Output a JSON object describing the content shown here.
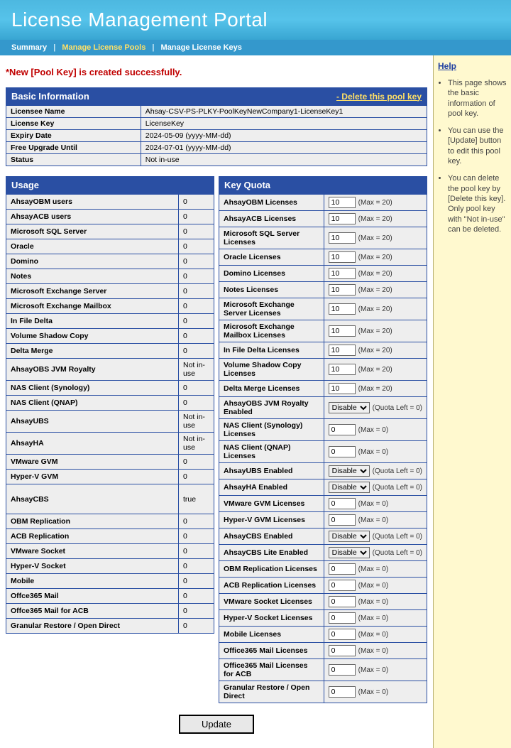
{
  "header": {
    "title": "License Management Portal"
  },
  "nav": {
    "summary": "Summary",
    "pools": "Manage License Pools",
    "keys": "Manage License Keys"
  },
  "message": "*New [Pool Key] is created successfully.",
  "basic": {
    "heading": "Basic Information",
    "deleteLink": "- Delete this pool key",
    "rows": [
      {
        "label": "Licensee Name",
        "value": "Ahsay-CSV-PS-PLKY-PoolKeyNewCompany1-LicenseKey1"
      },
      {
        "label": "License Key",
        "value": "LicenseKey"
      },
      {
        "label": "Expiry Date",
        "value": "2024-05-09 (yyyy-MM-dd)"
      },
      {
        "label": "Free Upgrade Until",
        "value": "2024-07-01 (yyyy-MM-dd)"
      },
      {
        "label": "Status",
        "value": "Not in-use"
      }
    ]
  },
  "usage": {
    "heading": "Usage",
    "rows": [
      {
        "label": "AhsayOBM users",
        "value": "0"
      },
      {
        "label": "AhsayACB users",
        "value": "0"
      },
      {
        "label": "Microsoft SQL Server",
        "value": "0"
      },
      {
        "label": "Oracle",
        "value": "0"
      },
      {
        "label": "Domino",
        "value": "0"
      },
      {
        "label": "Notes",
        "value": "0"
      },
      {
        "label": "Microsoft Exchange Server",
        "value": "0"
      },
      {
        "label": "Microsoft Exchange Mailbox",
        "value": "0"
      },
      {
        "label": "In File Delta",
        "value": "0"
      },
      {
        "label": "Volume Shadow Copy",
        "value": "0"
      },
      {
        "label": "Delta Merge",
        "value": "0"
      },
      {
        "label": "AhsayOBS JVM Royalty",
        "value": "Not in-use"
      },
      {
        "label": "NAS Client (Synology)",
        "value": "0"
      },
      {
        "label": "NAS Client (QNAP)",
        "value": "0"
      },
      {
        "label": "AhsayUBS",
        "value": "Not in-use"
      },
      {
        "label": "AhsayHA",
        "value": "Not in-use"
      },
      {
        "label": "VMware GVM",
        "value": "0"
      },
      {
        "label": "Hyper-V GVM",
        "value": "0"
      },
      {
        "label": "AhsayCBS",
        "value": "true",
        "span": 2
      },
      {
        "label": "OBM Replication",
        "value": "0"
      },
      {
        "label": "ACB Replication",
        "value": "0"
      },
      {
        "label": "VMware Socket",
        "value": "0"
      },
      {
        "label": "Hyper-V Socket",
        "value": "0"
      },
      {
        "label": "Mobile",
        "value": "0"
      },
      {
        "label": "Offce365 Mail",
        "value": "0"
      },
      {
        "label": "Offce365 Mail for ACB",
        "value": "0"
      },
      {
        "label": "Granular Restore / Open Direct",
        "value": "0"
      }
    ]
  },
  "quota": {
    "heading": "Key Quota",
    "rows": [
      {
        "label": "AhsayOBM Licenses",
        "type": "num",
        "value": "10",
        "hint": "(Max = 20)"
      },
      {
        "label": "AhsayACB Licenses",
        "type": "num",
        "value": "10",
        "hint": "(Max = 20)"
      },
      {
        "label": "Microsoft SQL Server Licenses",
        "type": "num",
        "value": "10",
        "hint": "(Max = 20)"
      },
      {
        "label": "Oracle Licenses",
        "type": "num",
        "value": "10",
        "hint": "(Max = 20)"
      },
      {
        "label": "Domino Licenses",
        "type": "num",
        "value": "10",
        "hint": "(Max = 20)"
      },
      {
        "label": "Notes Licenses",
        "type": "num",
        "value": "10",
        "hint": "(Max = 20)"
      },
      {
        "label": "Microsoft Exchange Server Licenses",
        "type": "num",
        "value": "10",
        "hint": "(Max = 20)"
      },
      {
        "label": "Microsoft Exchange Mailbox Licenses",
        "type": "num",
        "value": "10",
        "hint": "(Max = 20)"
      },
      {
        "label": "In File Delta Licenses",
        "type": "num",
        "value": "10",
        "hint": "(Max = 20)"
      },
      {
        "label": "Volume Shadow Copy Licenses",
        "type": "num",
        "value": "10",
        "hint": "(Max = 20)"
      },
      {
        "label": "Delta Merge Licenses",
        "type": "num",
        "value": "10",
        "hint": "(Max = 20)"
      },
      {
        "label": "AhsayOBS JVM Royalty Enabled",
        "type": "sel",
        "value": "Disable",
        "hint": "(Quota Left = 0)"
      },
      {
        "label": "NAS Client (Synology) Licenses",
        "type": "num",
        "value": "0",
        "hint": "(Max = 0)"
      },
      {
        "label": "NAS Client (QNAP) Licenses",
        "type": "num",
        "value": "0",
        "hint": "(Max = 0)"
      },
      {
        "label": "AhsayUBS Enabled",
        "type": "sel",
        "value": "Disable",
        "hint": "(Quota Left = 0)"
      },
      {
        "label": "AhsayHA Enabled",
        "type": "sel",
        "value": "Disable",
        "hint": "(Quota Left = 0)"
      },
      {
        "label": "VMware GVM Licenses",
        "type": "num",
        "value": "0",
        "hint": "(Max = 0)"
      },
      {
        "label": "Hyper-V GVM Licenses",
        "type": "num",
        "value": "0",
        "hint": "(Max = 0)"
      },
      {
        "label": "AhsayCBS Enabled",
        "type": "sel",
        "value": "Disable",
        "hint": "(Quota Left = 0)"
      },
      {
        "label": "AhsayCBS Lite Enabled",
        "type": "sel",
        "value": "Disable",
        "hint": "(Quota Left = 0)"
      },
      {
        "label": "OBM Replication Licenses",
        "type": "num",
        "value": "0",
        "hint": "(Max = 0)"
      },
      {
        "label": "ACB Replication Licenses",
        "type": "num",
        "value": "0",
        "hint": "(Max = 0)"
      },
      {
        "label": "VMware Socket Licenses",
        "type": "num",
        "value": "0",
        "hint": "(Max = 0)"
      },
      {
        "label": "Hyper-V Socket Licenses",
        "type": "num",
        "value": "0",
        "hint": "(Max = 0)"
      },
      {
        "label": "Mobile Licenses",
        "type": "num",
        "value": "0",
        "hint": "(Max = 0)"
      },
      {
        "label": "Office365 Mail Licenses",
        "type": "num",
        "value": "0",
        "hint": "(Max = 0)"
      },
      {
        "label": "Office365 Mail Licenses for ACB",
        "type": "num",
        "value": "0",
        "hint": "(Max = 0)"
      },
      {
        "label": "Granular Restore / Open Direct",
        "type": "num",
        "value": "0",
        "hint": "(Max = 0)"
      }
    ]
  },
  "updateLabel": "Update",
  "help": {
    "heading": "Help",
    "items": [
      "This page shows the basic information of pool key.",
      "You can use the [Update] button to edit this pool key.",
      "You can delete the pool key by [Delete this key]. Only pool key with \"Not in-use\" can be deleted."
    ]
  }
}
